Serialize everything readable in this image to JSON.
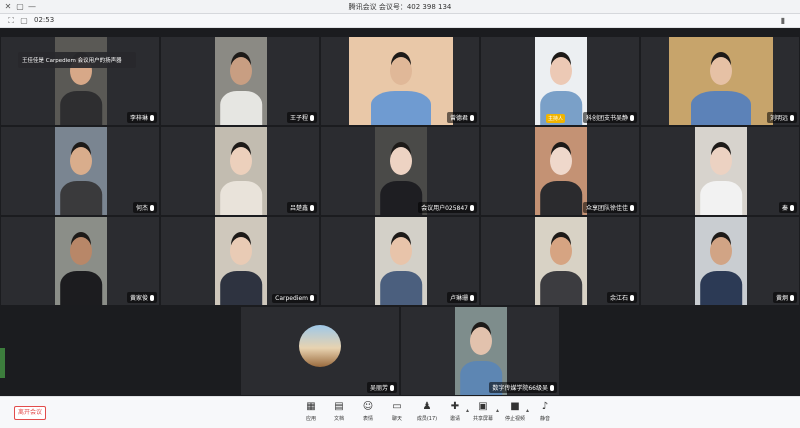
{
  "window": {
    "title": "腾讯会议  会议号：402 398 134",
    "controls": {
      "close": "✕",
      "maximize": "▢",
      "minimize": "—"
    }
  },
  "infobar": {
    "elapsed": "02:53",
    "icons": [
      "fullscreen-icon",
      "layout-icon",
      "network-signal-icon"
    ]
  },
  "toast": {
    "text": "王佳佳是 Carpediem 会议用户的扬声器"
  },
  "participants": [
    {
      "name": "李梓琳",
      "bg": "#5a5955",
      "skin": "#d7a888",
      "shirt": "#2e2e30"
    },
    {
      "name": "王子程",
      "bg": "#8b8a84",
      "skin": "#c89e82",
      "shirt": "#e6e6e2"
    },
    {
      "name": "曾德君",
      "bg": "#e9c8a8",
      "skin": "#e0b898",
      "shirt": "#6f9bd1"
    },
    {
      "name": "科创团支书吴静",
      "bg": "#eceff2",
      "skin": "#ecc9b5",
      "shirt": "#7aa0c8",
      "badge": "主持人"
    },
    {
      "name": "刘明远",
      "bg": "#c7a46b",
      "skin": "#e6c1a5",
      "shirt": "#5c82b8"
    },
    {
      "name": "何杰",
      "bg": "#7a8591",
      "skin": "#d9ad8c",
      "shirt": "#3a3a3c"
    },
    {
      "name": "吕楚鑫",
      "bg": "#c2bcb0",
      "skin": "#ecd0bc",
      "shirt": "#e9e3da"
    },
    {
      "name": "会议用户025847",
      "bg": "#4a4a48",
      "skin": "#edd3c3",
      "shirt": "#1e1e22"
    },
    {
      "name": "众享团队徐佳佳",
      "bg": "#c49274",
      "skin": "#efd8cb",
      "shirt": "#2b2b2e"
    },
    {
      "name": "秦",
      "bg": "#d7d3cd",
      "skin": "#ecd2c2",
      "shirt": "#f2f2f2"
    },
    {
      "name": "黄家俊",
      "bg": "#8b8e88",
      "skin": "#b88768",
      "shirt": "#1c1c1f"
    },
    {
      "name": "Carpediem",
      "bg": "#cfc8bc",
      "skin": "#e9cbb5",
      "shirt": "#2e3340"
    },
    {
      "name": "卢琳珊",
      "bg": "#d3d0c8",
      "skin": "#e8c4aa",
      "shirt": "#4b5f7e"
    },
    {
      "name": "余江石",
      "bg": "#d8d2c5",
      "skin": "#d6a482",
      "shirt": "#3c3c40"
    },
    {
      "name": "黄炯",
      "bg": "#c9cdd1",
      "skin": "#d1a485",
      "shirt": "#2c3a55"
    },
    {
      "name": "吴丽芳",
      "avatar": true
    },
    {
      "name": "数字传媒学院66级吴",
      "bg": "#7e8d8c",
      "skin": "#e2c2ad",
      "shirt": "#5d86b3"
    }
  ],
  "toolbar": {
    "leave_label": "离开会议",
    "tools": [
      {
        "label": "应用",
        "icon": "apps-icon",
        "glyph": "▦"
      },
      {
        "label": "文档",
        "icon": "document-icon",
        "glyph": "▤"
      },
      {
        "label": "表情",
        "icon": "emoji-icon",
        "glyph": "☺"
      },
      {
        "label": "聊天",
        "icon": "chat-icon",
        "glyph": "▭"
      },
      {
        "label": "成员(17)",
        "icon": "members-icon",
        "glyph": "♟"
      },
      {
        "label": "邀请",
        "icon": "invite-icon",
        "glyph": "✚"
      },
      {
        "label": "共享屏幕",
        "icon": "share-screen-icon",
        "glyph": "▣"
      },
      {
        "label": "停止视频",
        "icon": "video-icon",
        "glyph": "■"
      },
      {
        "label": "静音",
        "icon": "microphone-icon",
        "glyph": "♪"
      }
    ]
  }
}
